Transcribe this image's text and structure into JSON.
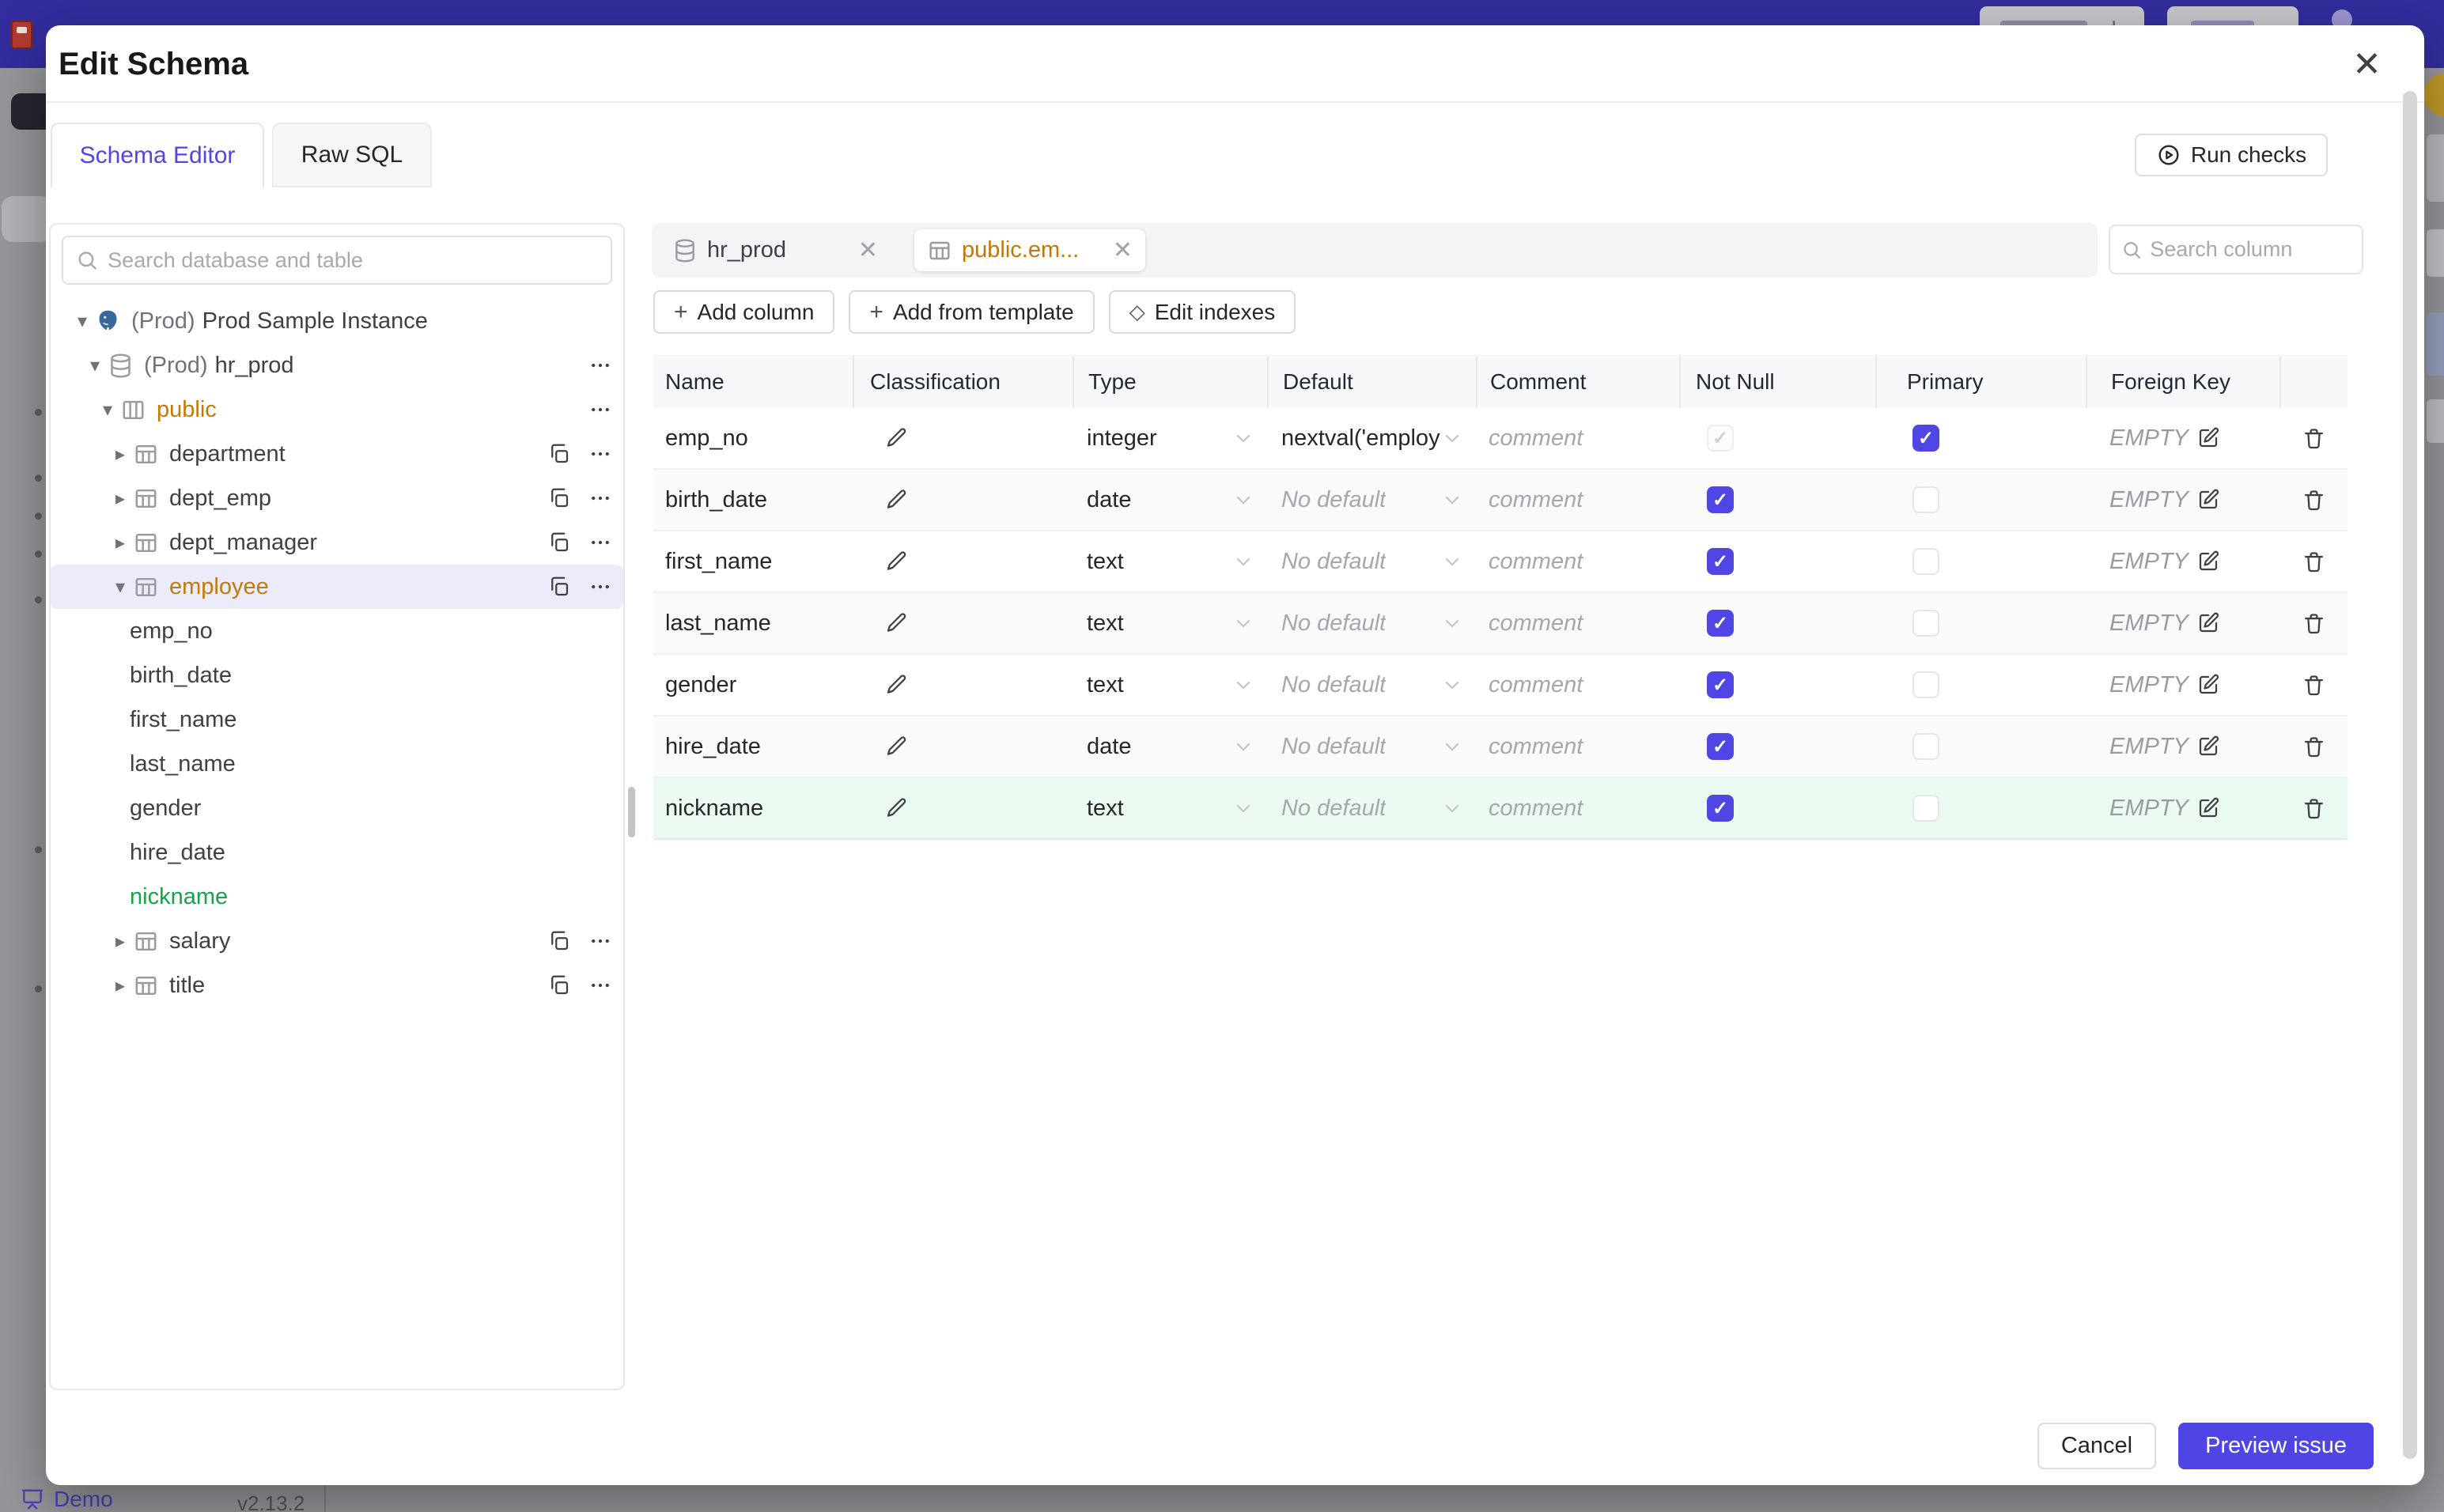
{
  "colors": {
    "accent": "#4f46e5",
    "topbar": "#332d9e",
    "amber": "#c27a08",
    "green": "#16a34a",
    "green_row": "#eafaf1",
    "selected_row": "#ecebfa",
    "primary_button": "#4f45e4"
  },
  "icons": {
    "close": "✕",
    "plus": "+",
    "diamond": "◇",
    "caret_expanded": "▾",
    "caret_collapsed": "▸",
    "check": "✓"
  },
  "backdrop": {
    "demo_label": "Demo",
    "version": "v2.13.2"
  },
  "modal": {
    "title": "Edit Schema",
    "tabs": [
      {
        "label": "Schema Editor",
        "active": true
      },
      {
        "label": "Raw SQL",
        "active": false
      }
    ],
    "run_checks_label": "Run checks",
    "sidebar": {
      "search_placeholder": "Search database and table",
      "tree": [
        {
          "level": 0,
          "caret": "down",
          "icon": "postgresql",
          "prefix": "(Prod)",
          "label": "Prod Sample Instance",
          "color": "default",
          "selected": false,
          "actions": []
        },
        {
          "level": 1,
          "caret": "down",
          "icon": "database",
          "prefix": "(Prod)",
          "label": "hr_prod",
          "color": "default",
          "selected": false,
          "actions": [
            "more"
          ]
        },
        {
          "level": 2,
          "caret": "down",
          "icon": "schema",
          "prefix": "",
          "label": "public",
          "color": "amber",
          "selected": false,
          "actions": [
            "more"
          ]
        },
        {
          "level": 3,
          "caret": "right",
          "icon": "table",
          "prefix": "",
          "label": "department",
          "color": "default",
          "selected": false,
          "actions": [
            "copy",
            "more"
          ]
        },
        {
          "level": 3,
          "caret": "right",
          "icon": "table",
          "prefix": "",
          "label": "dept_emp",
          "color": "default",
          "selected": false,
          "actions": [
            "copy",
            "more"
          ]
        },
        {
          "level": 3,
          "caret": "right",
          "icon": "table",
          "prefix": "",
          "label": "dept_manager",
          "color": "default",
          "selected": false,
          "actions": [
            "copy",
            "more"
          ]
        },
        {
          "level": 3,
          "caret": "down",
          "icon": "table",
          "prefix": "",
          "label": "employee",
          "color": "amber",
          "selected": true,
          "actions": [
            "copy",
            "more"
          ]
        },
        {
          "level": 4,
          "caret": "none",
          "icon": "none",
          "prefix": "",
          "label": "emp_no",
          "color": "default",
          "selected": false,
          "actions": []
        },
        {
          "level": 4,
          "caret": "none",
          "icon": "none",
          "prefix": "",
          "label": "birth_date",
          "color": "default",
          "selected": false,
          "actions": []
        },
        {
          "level": 4,
          "caret": "none",
          "icon": "none",
          "prefix": "",
          "label": "first_name",
          "color": "default",
          "selected": false,
          "actions": []
        },
        {
          "level": 4,
          "caret": "none",
          "icon": "none",
          "prefix": "",
          "label": "last_name",
          "color": "default",
          "selected": false,
          "actions": []
        },
        {
          "level": 4,
          "caret": "none",
          "icon": "none",
          "prefix": "",
          "label": "gender",
          "color": "default",
          "selected": false,
          "actions": []
        },
        {
          "level": 4,
          "caret": "none",
          "icon": "none",
          "prefix": "",
          "label": "hire_date",
          "color": "default",
          "selected": false,
          "actions": []
        },
        {
          "level": 4,
          "caret": "none",
          "icon": "none",
          "prefix": "",
          "label": "nickname",
          "color": "green",
          "selected": false,
          "actions": []
        },
        {
          "level": 3,
          "caret": "right",
          "icon": "table",
          "prefix": "",
          "label": "salary",
          "color": "default",
          "selected": false,
          "actions": [
            "copy",
            "more"
          ]
        },
        {
          "level": 3,
          "caret": "right",
          "icon": "table",
          "prefix": "",
          "label": "title",
          "color": "default",
          "selected": false,
          "actions": [
            "copy",
            "more"
          ]
        }
      ]
    },
    "main": {
      "chips": [
        {
          "icon": "database",
          "label": "hr_prod",
          "active": false
        },
        {
          "icon": "table",
          "label": "public.em...",
          "active": true
        }
      ],
      "column_search_placeholder": "Search column",
      "toolbar": [
        {
          "icon": "plus",
          "label": "Add column"
        },
        {
          "icon": "plus",
          "label": "Add from template"
        },
        {
          "icon": "diamond",
          "label": "Edit indexes"
        }
      ],
      "table": {
        "headers": [
          "Name",
          "Classification",
          "Type",
          "Default",
          "Comment",
          "Not Null",
          "Primary",
          "Foreign Key",
          ""
        ],
        "comment_placeholder": "comment",
        "foreign_key_empty": "EMPTY",
        "rows": [
          {
            "name": "emp_no",
            "type": "integer",
            "default": "nextval('employ",
            "default_is_placeholder": false,
            "not_null_checked": true,
            "not_null_disabled": true,
            "primary_checked": true,
            "highlight": false
          },
          {
            "name": "birth_date",
            "type": "date",
            "default": "No default",
            "default_is_placeholder": true,
            "not_null_checked": true,
            "not_null_disabled": false,
            "primary_checked": false,
            "highlight": false
          },
          {
            "name": "first_name",
            "type": "text",
            "default": "No default",
            "default_is_placeholder": true,
            "not_null_checked": true,
            "not_null_disabled": false,
            "primary_checked": false,
            "highlight": false
          },
          {
            "name": "last_name",
            "type": "text",
            "default": "No default",
            "default_is_placeholder": true,
            "not_null_checked": true,
            "not_null_disabled": false,
            "primary_checked": false,
            "highlight": false
          },
          {
            "name": "gender",
            "type": "text",
            "default": "No default",
            "default_is_placeholder": true,
            "not_null_checked": true,
            "not_null_disabled": false,
            "primary_checked": false,
            "highlight": false
          },
          {
            "name": "hire_date",
            "type": "date",
            "default": "No default",
            "default_is_placeholder": true,
            "not_null_checked": true,
            "not_null_disabled": false,
            "primary_checked": false,
            "highlight": false
          },
          {
            "name": "nickname",
            "type": "text",
            "default": "No default",
            "default_is_placeholder": true,
            "not_null_checked": true,
            "not_null_disabled": false,
            "primary_checked": false,
            "highlight": true
          }
        ]
      }
    },
    "footer": {
      "cancel_label": "Cancel",
      "primary_label": "Preview issue"
    }
  }
}
